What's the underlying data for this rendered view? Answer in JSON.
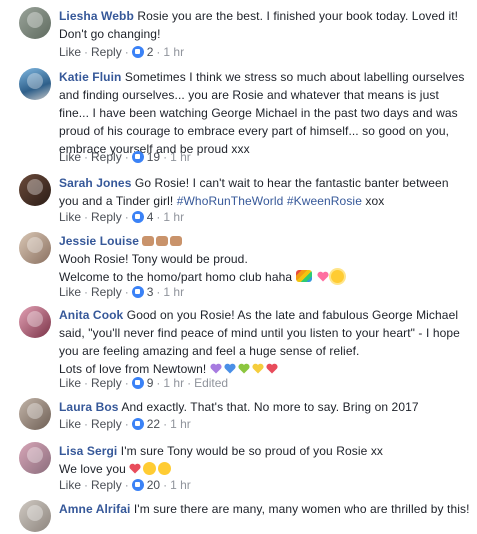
{
  "actions": {
    "like": "Like",
    "reply": "Reply",
    "dot": "·"
  },
  "comments": [
    {
      "name": "Liesha Webb",
      "text": "Rosie you are the best. I finished your book today. Loved it! Don't go changing!",
      "likes": "2",
      "time": "1 hr"
    },
    {
      "name": "Katie Fluin",
      "text": "Sometimes I think we stress so much about labelling ourselves and finding ourselves... you are Rosie and whatever that means is just fine... I have been watching George Michael in the past two days and was proud of his courage to embrace every part of himself... so good on you, embrace yourself and be proud xxx",
      "likes": "19",
      "time": "1 hr"
    },
    {
      "name": "Sarah Jones",
      "text": "Go Rosie! I can't wait to hear the fantastic banter between you and a Tinder girl!",
      "hashtags": [
        "#WhoRunTheWorld",
        "#KweenRosie"
      ],
      "text_after": "xox",
      "likes": "4",
      "time": "1 hr"
    },
    {
      "name": "Jessie Louise",
      "line2": "Wooh Rosie! Tony would be proud.",
      "line3": "Welcome to the homo/part homo club haha",
      "likes": "3",
      "time": "1 hr"
    },
    {
      "name": "Anita Cook",
      "text": "Good on you Rosie! As the late and fabulous George Michael said, \"you'll never find peace of mind until you listen to your heart\" - I hope you are feeling amazing and feel a huge sense of relief.",
      "line2": "Lots of love from Newtown!",
      "likes": "9",
      "time": "1 hr",
      "edited": "Edited"
    },
    {
      "name": "Laura Bos",
      "text": "And exactly. That's that. No more to say. Bring on 2017",
      "likes": "22",
      "time": "1 hr"
    },
    {
      "name": "Lisa Sergi",
      "text": "I'm sure Tony would be so proud of you Rosie xx",
      "line2": "We love you",
      "likes": "20",
      "time": "1 hr"
    },
    {
      "name": "Amne Alrifai",
      "text": "I'm sure there are many, many women who are thrilled by this!"
    }
  ],
  "colors": {
    "name": "#365899",
    "meta": "#4b4f56",
    "time": "#90949c",
    "like_badge": "#3b82f6"
  }
}
